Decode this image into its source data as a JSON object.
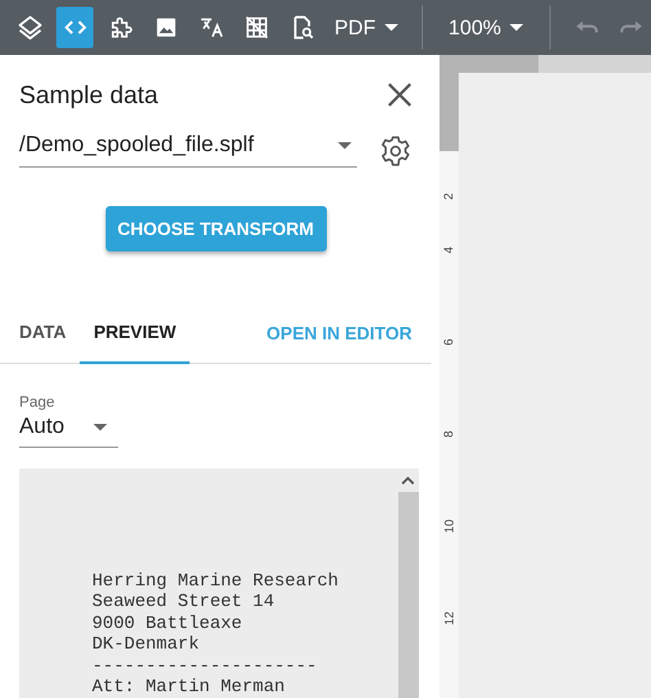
{
  "toolbar": {
    "tools": [
      {
        "selected": false
      },
      {
        "selected": true
      },
      {
        "selected": false
      },
      {
        "selected": false
      },
      {
        "selected": false
      },
      {
        "selected": false
      },
      {
        "selected": false
      }
    ],
    "format_menu": {
      "label": "PDF"
    },
    "zoom_menu": {
      "label": "100%"
    },
    "history": [
      {
        "disabled": true
      },
      {
        "disabled": true
      }
    ]
  },
  "panel": {
    "title": "Sample data",
    "file_select": {
      "value": "/Demo_spooled_file.splf"
    },
    "choose_button": "CHOOSE TRANSFORM",
    "tabs": [
      {
        "label": "DATA",
        "selected": false
      },
      {
        "label": "PREVIEW",
        "selected": true
      }
    ],
    "open_editor": "OPEN IN EDITOR",
    "page_select": {
      "label": "Page",
      "value": "Auto"
    },
    "preview_lines": [
      "Herring Marine Research",
      "Seaweed Street 14",
      "9000 Battleaxe",
      "DK-Denmark",
      "---------------------",
      "Att: Martin Merman"
    ]
  },
  "ruler": {
    "ticks": [
      "2",
      "4",
      "6",
      "8",
      "10",
      "12"
    ]
  }
}
